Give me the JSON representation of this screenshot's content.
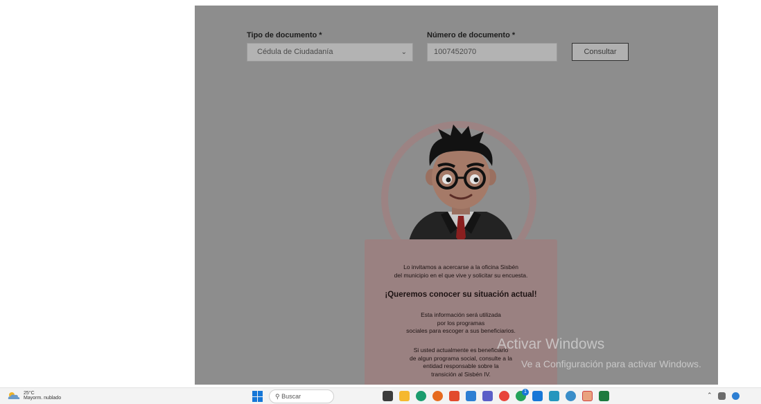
{
  "form": {
    "doc_type_label": "Tipo de documento *",
    "doc_type_value": "Cédula de Ciudadanía",
    "doc_number_label": "Número de documento *",
    "doc_number_value": "1007452070",
    "consult_button": "Consultar"
  },
  "modal": {
    "message_1": "Lo invitamos a acercarse a la oficina Sisbén\ndel municipio en el que vive y solicitar su encuesta.",
    "heading": "¡Queremos conocer su situación actual!",
    "message_2": "Esta información será utilizada\npor los programas\nsociales para escoger a sus beneficiarios.",
    "message_3": "Si usted actualmente es beneficiario\nde algun programa social, consulte a la\nentidad responsable sobre la\ntransición al Sisbén IV."
  },
  "watermark": {
    "title": "Activar Windows",
    "subtitle": "Ve a Configuración para activar Windows."
  },
  "taskbar": {
    "weather_temp": "25°C",
    "weather_desc": "Mayorm. nublado",
    "search_placeholder": "Buscar",
    "whatsapp_badge": "1",
    "icons": [
      "start-icon",
      "task-view-icon",
      "file-explorer-icon",
      "edge-icon",
      "firefox-icon",
      "brave-icon",
      "photos-icon",
      "teams-icon",
      "chrome-icon",
      "whatsapp-icon",
      "mail-icon",
      "store-icon",
      "chrome-profile-icon",
      "sticky-notes-icon",
      "excel-icon"
    ]
  },
  "colors": {
    "overlay": "#8d8d8d",
    "card": "#9a8181",
    "ring": "#9c8383",
    "taskbar": "#f3f3f3",
    "windows_blue": "#1677d7"
  }
}
